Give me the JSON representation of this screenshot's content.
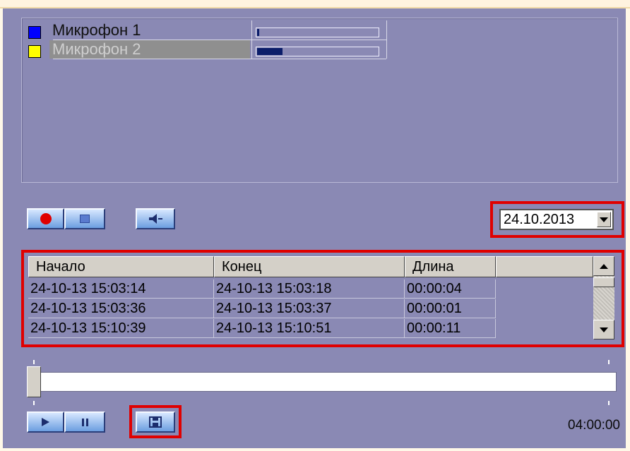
{
  "microphones": [
    {
      "name": "Микрофон 1",
      "color": "#0000ff",
      "level": 0.02,
      "selected": false
    },
    {
      "name": "Микрофон 2",
      "color": "#ffff00",
      "level": 0.21,
      "selected": true
    }
  ],
  "record_controls": {
    "record_icon": "record-icon",
    "stop_icon": "stop-icon",
    "speaker_icon": "speaker-icon"
  },
  "date_picker": {
    "value": "24.10.2013"
  },
  "table": {
    "columns": [
      "Начало",
      "Конец",
      "Длина"
    ],
    "rows": [
      [
        "24-10-13 15:03:14",
        "24-10-13 15:03:18",
        "00:00:04"
      ],
      [
        "24-10-13 15:03:36",
        "24-10-13 15:03:37",
        "00:00:01"
      ],
      [
        "24-10-13 15:10:39",
        "24-10-13 15:10:51",
        "00:00:11"
      ]
    ]
  },
  "playback": {
    "play_icon": "play-icon",
    "pause_icon": "pause-icon",
    "save_icon": "floppy-save-icon",
    "time": "04:00:00",
    "position": 0.0
  },
  "colors": {
    "highlight": "#e00000",
    "panel": "#8a89b4"
  }
}
